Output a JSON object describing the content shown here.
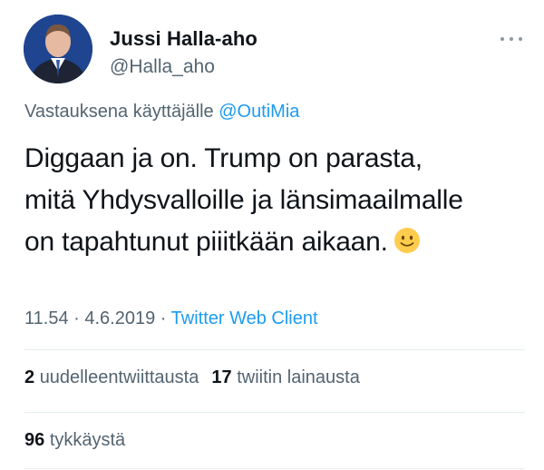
{
  "author": {
    "display_name": "Jussi Halla-aho",
    "handle": "@Halla_aho"
  },
  "reply": {
    "prefix": "Vastauksena käyttäjälle ",
    "mention": "@OutiMia"
  },
  "tweet": {
    "line1": "Diggaan ja on. Trump on parasta,",
    "line2": "mitä Yhdysvalloille ja länsimaailmalle",
    "line3": "on tapahtunut piiitkään aikaan.",
    "emoji": "slightly-smiling-face"
  },
  "meta": {
    "time": "11.54",
    "sep1": " · ",
    "date": "4.6.2019",
    "sep2": " · ",
    "source": "Twitter Web Client"
  },
  "stats": {
    "retweets_count": "2",
    "retweets_label": "uudelleentwiittausta",
    "quotes_count": "17",
    "quotes_label": "twiitin lainausta",
    "likes_count": "96",
    "likes_label": "tykkäystä"
  },
  "colors": {
    "link": "#1d9bf0",
    "secondary_text": "#536471",
    "primary_text": "#0f1419",
    "divider": "#e6ecf0"
  },
  "icons": {
    "more": "more-horizontal-icon"
  }
}
